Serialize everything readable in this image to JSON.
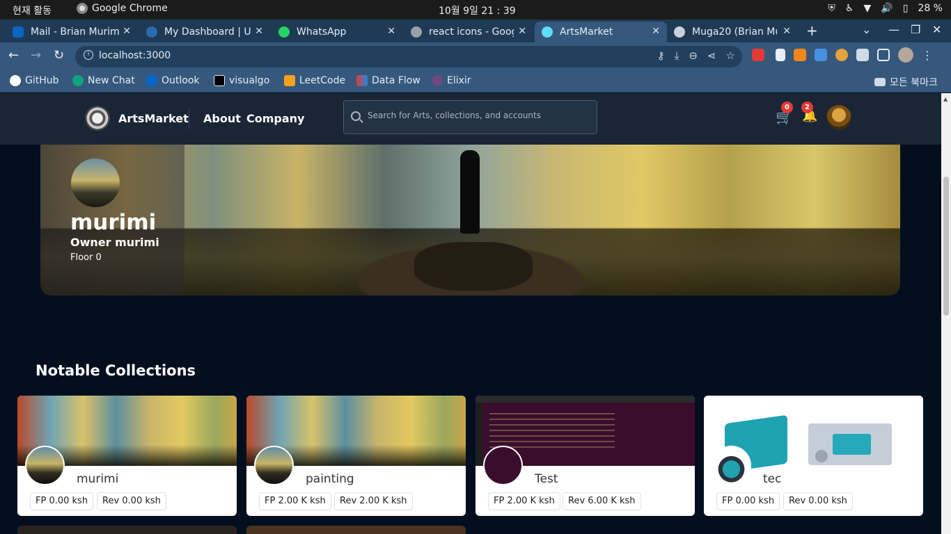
{
  "os": {
    "activities": "현재 활동",
    "app": "Google Chrome",
    "clock": "10월 9일  21 : 39",
    "battery": "28 %"
  },
  "tabs": [
    {
      "title": "Mail - Brian Murim",
      "color": "#0a66c2"
    },
    {
      "title": "My Dashboard | Us",
      "color": "#2b6cb0"
    },
    {
      "title": "WhatsApp",
      "color": "#25d366"
    },
    {
      "title": "react icons - Goog",
      "color": "#9aa0a6"
    },
    {
      "title": "ArtsMarket",
      "color": "#61dafb"
    },
    {
      "title": "Muga20 (Brian Mu",
      "color": "#c9d1d9"
    }
  ],
  "address": {
    "url": "localhost:3000"
  },
  "bookmarks": [
    {
      "label": "GitHub",
      "color": "#ffffff"
    },
    {
      "label": "New Chat",
      "color": "#10a37f"
    },
    {
      "label": "Outlook",
      "color": "#0a66c2"
    },
    {
      "label": "visualgo",
      "color": "#000000"
    },
    {
      "label": "LeetCode",
      "color": "#f89f1b"
    },
    {
      "label": "Data Flow",
      "color": "#e53935"
    },
    {
      "label": "Elixir",
      "color": "#6e4a7e"
    }
  ],
  "bookmarks_folder": "모든 북마크",
  "site": {
    "brand": "ArtsMarket",
    "nav": {
      "about": "About",
      "company": "Company"
    },
    "search_placeholder": "Search for Arts, collections, and accounts",
    "cart_count": "0",
    "notifications_count": "2"
  },
  "profile": {
    "name": "murimi",
    "owner": "Owner murimi",
    "floor": "Floor 0"
  },
  "collections_title": "Notable Collections",
  "collections": [
    {
      "name": "murimi",
      "fp": "FP 0.00 ksh",
      "rev": "Rev 0.00 ksh",
      "cover": "mural"
    },
    {
      "name": "painting",
      "fp": "FP 2.00 K ksh",
      "rev": "Rev 2.00 K ksh",
      "cover": "mural"
    },
    {
      "name": "Test",
      "fp": "FP 2.00 K ksh",
      "rev": "Rev 6.00 K ksh",
      "cover": "code"
    },
    {
      "name": "tec",
      "fp": "FP 0.00 ksh",
      "rev": "Rev 0.00 ksh",
      "cover": "illus"
    }
  ],
  "colors": {
    "accent": "#e53935",
    "page_bg": "#030f1f",
    "header_bg": "#1a2536"
  }
}
